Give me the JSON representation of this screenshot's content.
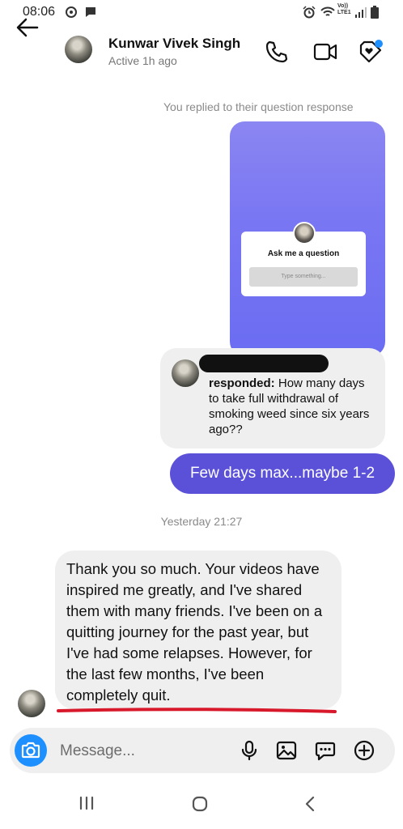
{
  "status_bar": {
    "time": "08:06",
    "network": "Vo))\nLTE1"
  },
  "header": {
    "name": "Kunwar Vivek Singh",
    "status": "Active 1h ago"
  },
  "messages": {
    "reply_note": "You replied to their question response",
    "story": {
      "title": "Ask me a question",
      "input_placeholder": "Type something..."
    },
    "response": {
      "label": "responded:",
      "text": " How many days to take full withdrawal of smoking weed since six years ago??"
    },
    "sent": "Few days max...maybe 1-2",
    "timestamp": "Yesterday 21:27",
    "received": "Thank you so much. Your videos have inspired me greatly, and I've shared them with many friends. I've been on a quitting journey for the past year, but I've had some relapses. However, for the last few months, I've been completely quit."
  },
  "composer": {
    "placeholder": "Message..."
  },
  "colors": {
    "sent_bubble": "#5b51d8",
    "camera_button": "#1e8fff",
    "received_bubble": "#efefef",
    "underline": "#d8182b",
    "notification_dot": "#1e8fff"
  },
  "icons": {
    "status": [
      "alarm-icon",
      "wifi-icon",
      "signal-icon",
      "battery-icon"
    ],
    "header": [
      "back-arrow-icon",
      "phone-icon",
      "video-camera-icon",
      "tag-heart-icon"
    ],
    "composer": [
      "camera-icon",
      "microphone-icon",
      "gallery-icon",
      "sticker-chat-icon",
      "plus-circle-icon"
    ],
    "nav": [
      "recent-apps-icon",
      "home-icon",
      "back-icon"
    ]
  }
}
